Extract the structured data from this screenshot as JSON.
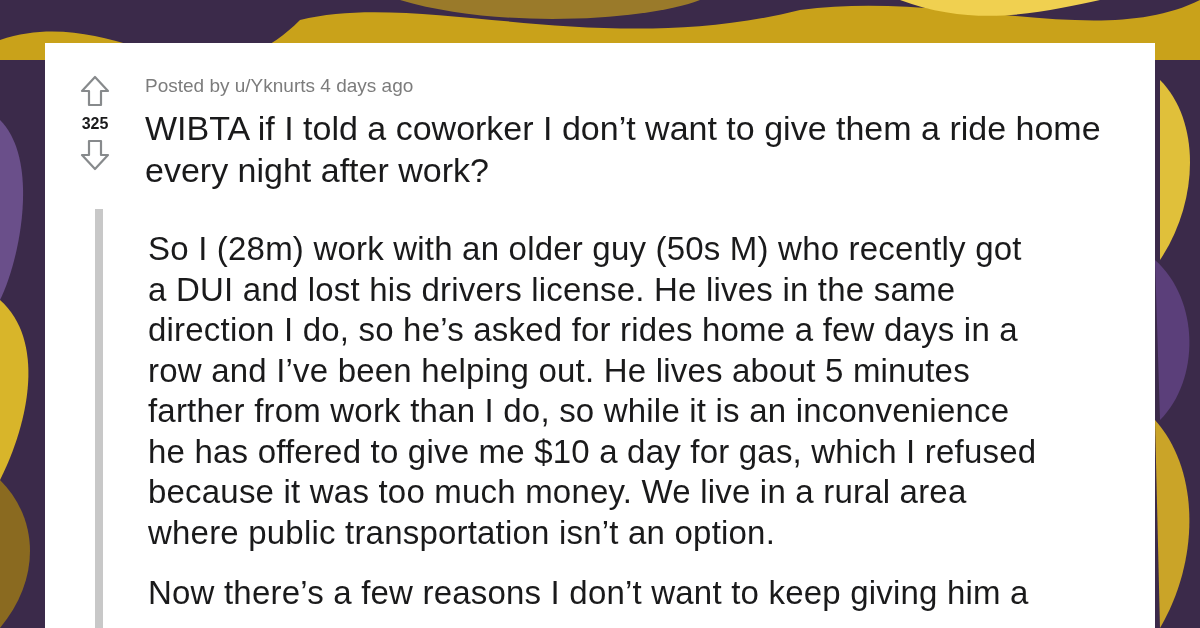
{
  "post": {
    "byline": "Posted by u/Yknurts 4 days ago",
    "score": "325",
    "title": "WIBTA if I told a coworker I don’t want to give them a ride home every night after work?",
    "paragraphs": [
      "So I (28m) work with an older guy (50s M) who recently got\na DUI and lost his drivers license. He lives in the same\ndirection I do, so he’s asked for rides home a few days in a\nrow and I’ve been helping out. He lives about 5 minutes\nfarther from work than I do, so while it is an inconvenience\nhe has offered to give me $10 a day for gas, which I refused\nbecause it was too much money. We live in a rural area\nwhere public transportation isn’t an option.",
      "Now there’s a few reasons I don’t want to keep giving him a"
    ]
  }
}
